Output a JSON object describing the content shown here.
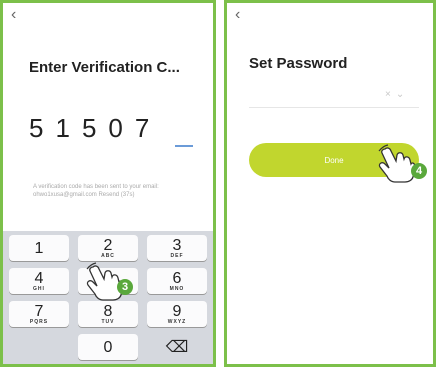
{
  "left": {
    "back_icon": "‹",
    "title": "Enter Verification C...",
    "code_digits": [
      "5",
      "1",
      "5",
      "0",
      "7"
    ],
    "hint": "A verification code has been sent to your email: ohwo1xusa@gmail.com Resend (37s)",
    "keys": [
      {
        "num": "1",
        "letters": ""
      },
      {
        "num": "2",
        "letters": "ABC"
      },
      {
        "num": "3",
        "letters": "DEF"
      },
      {
        "num": "4",
        "letters": "GHI"
      },
      {
        "num": "5",
        "letters": ""
      },
      {
        "num": "6",
        "letters": "MNO"
      },
      {
        "num": "7",
        "letters": "PQRS"
      },
      {
        "num": "8",
        "letters": "TUV"
      },
      {
        "num": "9",
        "letters": "WXYZ"
      },
      {
        "num": "0",
        "letters": ""
      }
    ],
    "delete_icon": "⌫",
    "step_badge": "3"
  },
  "right": {
    "back_icon": "‹",
    "title": "Set Password",
    "clear_icon": "×",
    "toggle_icon": "⌄",
    "done_label": "Done",
    "step_badge": "4"
  },
  "colors": {
    "frame": "#7cc04a",
    "done_button": "#c1d62e",
    "badge": "#5aa83c",
    "cursor": "#6b9bd8"
  }
}
